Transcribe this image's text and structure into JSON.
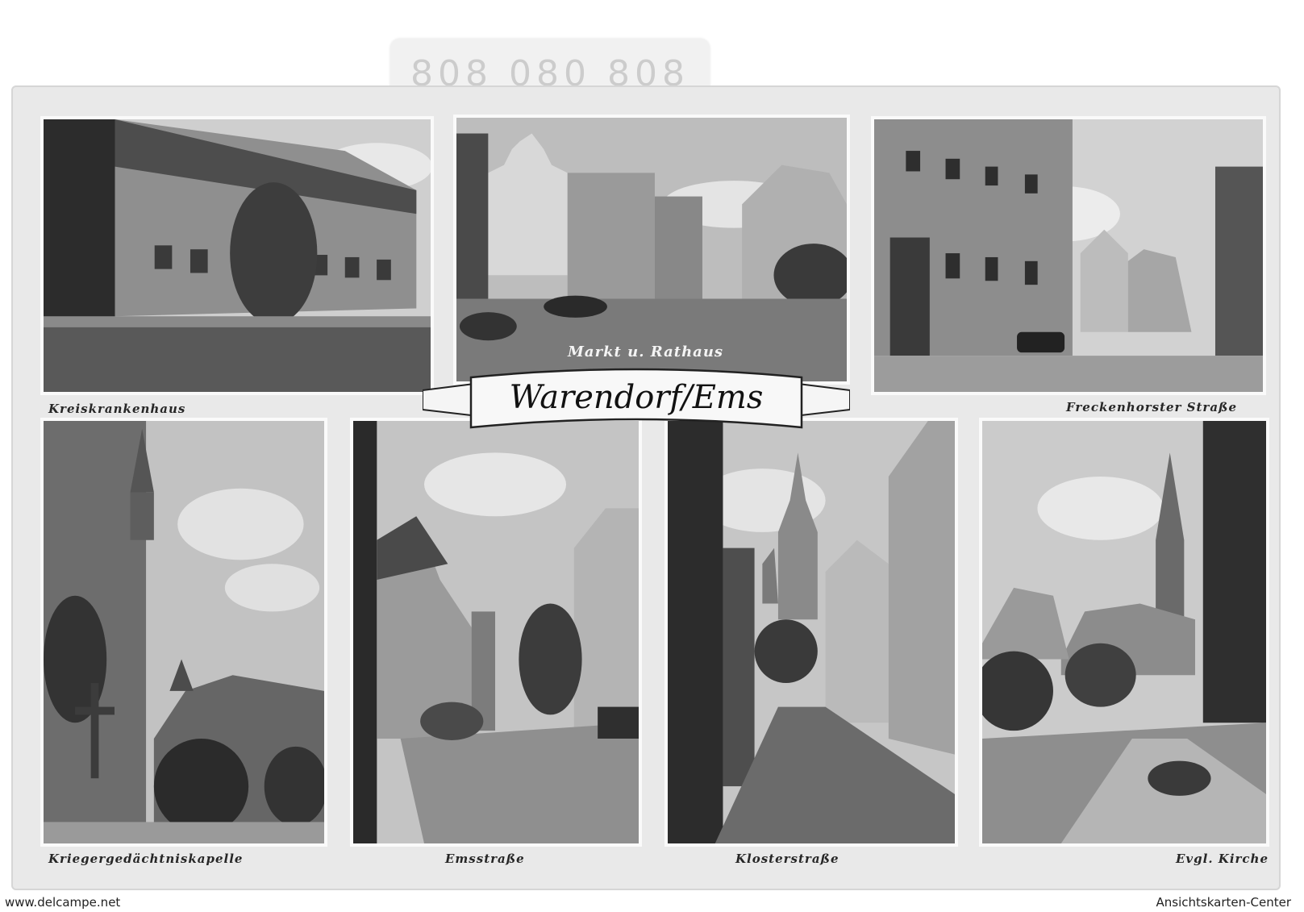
{
  "sticker": {
    "text": "808 080 808"
  },
  "banner": {
    "title": "Warendorf/Ems"
  },
  "photos": [
    {
      "id": "kreiskrankenhaus",
      "caption": "Kreiskrankenhaus"
    },
    {
      "id": "markt",
      "caption": "Markt u. Rathaus"
    },
    {
      "id": "freckenhorster",
      "caption": "Freckenhorster Straße"
    },
    {
      "id": "kriegergedaechtnis",
      "caption": "Kriegergedächtniskapelle"
    },
    {
      "id": "emsstrasse",
      "caption": "Emsstraße"
    },
    {
      "id": "klosterstrasse",
      "caption": "Klosterstraße"
    },
    {
      "id": "evgl-kirche",
      "caption": "Evgl. Kirche"
    }
  ],
  "footer": {
    "left": "www.delcampe.net",
    "right": "Ansichtskarten-Center"
  },
  "colors": {
    "card": "#e9e9e9",
    "photo_border": "#fafafa",
    "sky": "#c9c9c9"
  }
}
